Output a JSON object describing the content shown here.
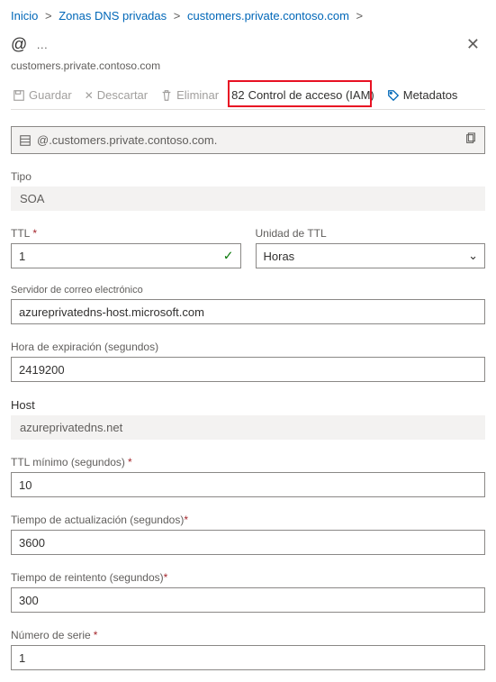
{
  "breadcrumbs": {
    "home": "Inicio",
    "zones": "Zonas DNS privadas",
    "zone": "customers.private.contoso.com"
  },
  "header": {
    "record_glyph": "@",
    "subtitle": "customers.private.contoso.com"
  },
  "toolbar": {
    "save": "Guardar",
    "discard": "Descartar",
    "delete": "Eliminar",
    "iam": "Control de acceso (IAM)",
    "iam_badge": "82",
    "metadata": "Metadatos"
  },
  "fqdn": {
    "value": "@.customers.private.contoso.com."
  },
  "fields": {
    "type_label": "Tipo",
    "type_value": "SOA",
    "ttl_label": "TTL",
    "ttl_value": "1",
    "ttl_unit_label": "Unidad de TTL",
    "ttl_unit_value": "Horas",
    "mail_label": "Servidor de correo electrónico",
    "mail_value": "azureprivatedns-host.microsoft.com",
    "expire_label": "Hora de expiración (segundos)",
    "expire_value": "2419200",
    "host_label": "Host",
    "host_value": "azureprivatedns.net",
    "min_ttl_label": "TTL mínimo (segundos)",
    "min_ttl_value": "10",
    "refresh_label": "Tiempo de actualización (segundos)",
    "refresh_value": "3600",
    "retry_label": "Tiempo de reintento (segundos)",
    "retry_value": "300",
    "serial_label": "Número de serie",
    "serial_value": "1"
  }
}
